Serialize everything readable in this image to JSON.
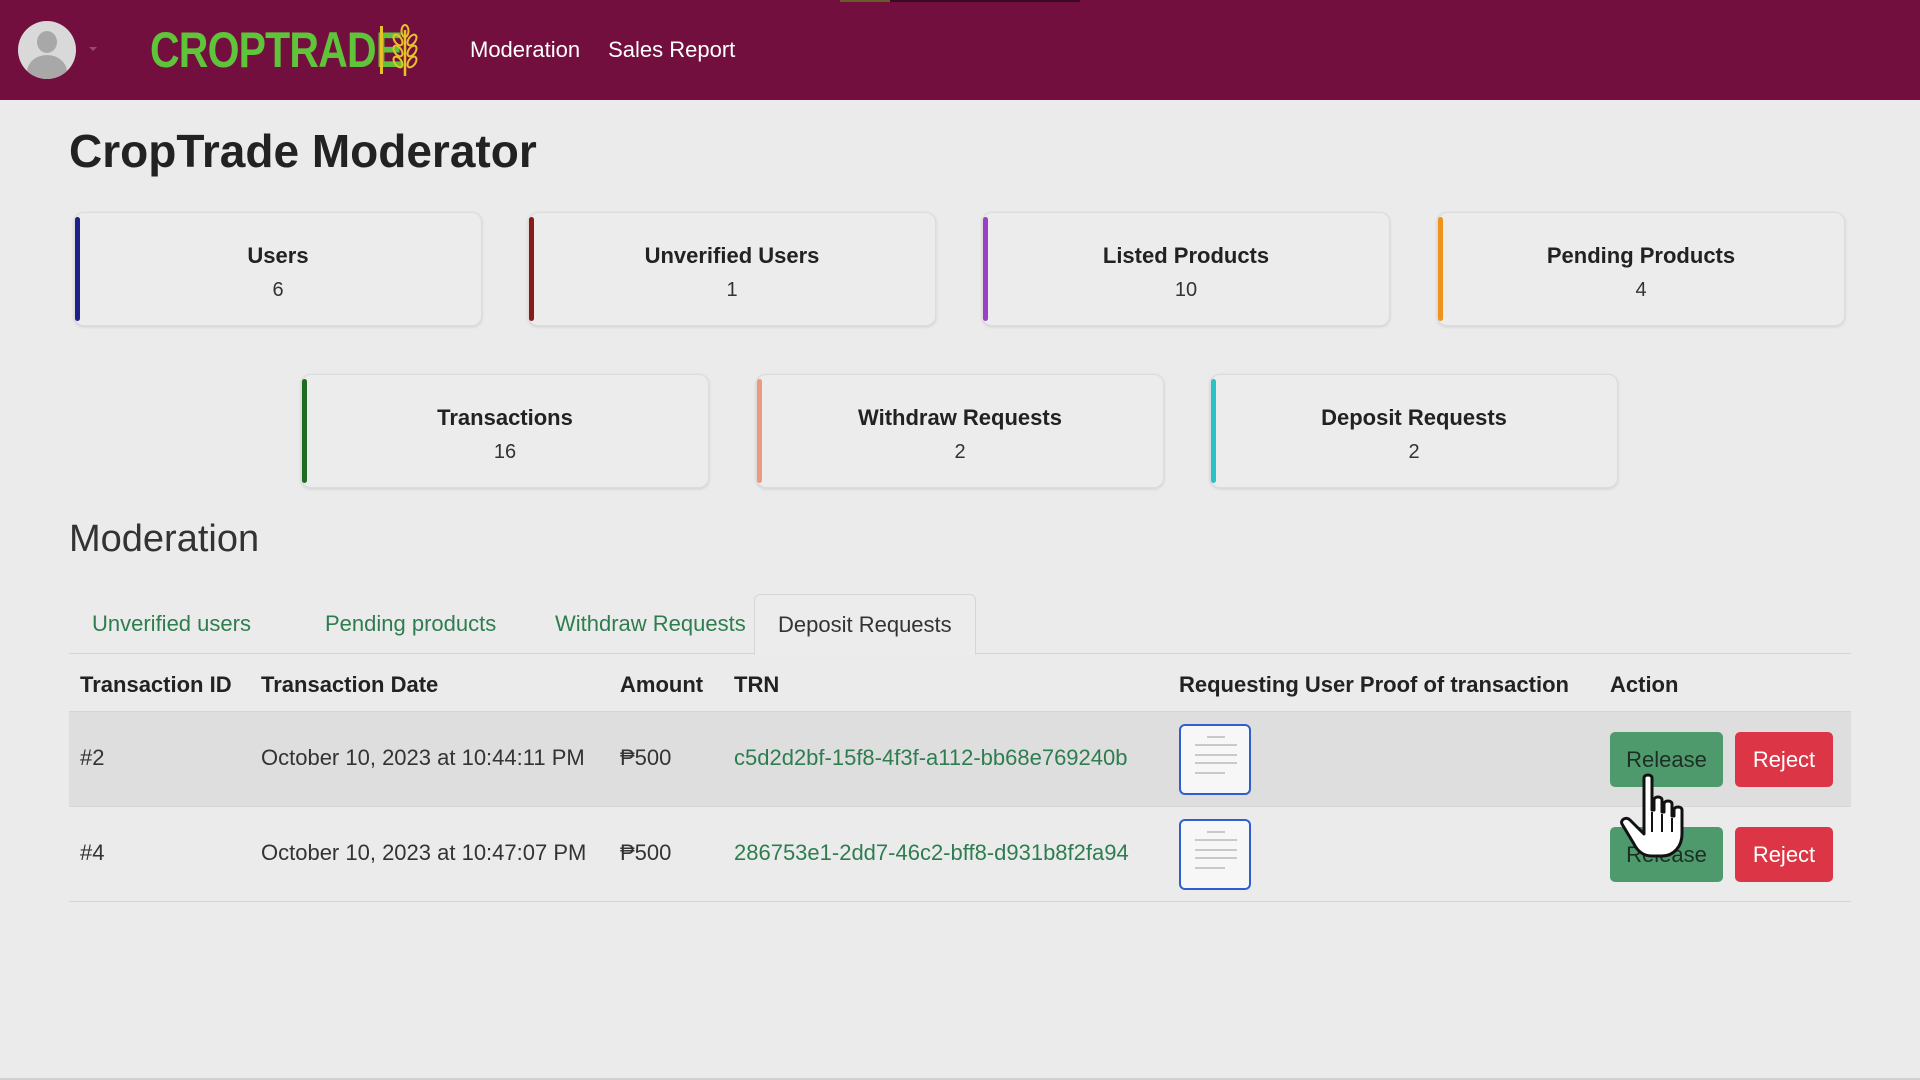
{
  "navbar": {
    "brand": "CROPTRADE",
    "links": [
      "Moderation",
      "Sales Report"
    ],
    "colors": {
      "background": "#730f3f",
      "brand": "#5ec43a",
      "brand_accent": "#e6c229"
    }
  },
  "page_title": "CropTrade Moderator",
  "stats": [
    {
      "label": "Users",
      "value": "6",
      "accent": "#1f1f8a"
    },
    {
      "label": "Unverified Users",
      "value": "1",
      "accent": "#8b1a1a"
    },
    {
      "label": "Listed Products",
      "value": "10",
      "accent": "#9b3fc9"
    },
    {
      "label": "Pending Products",
      "value": "4",
      "accent": "#f0921e"
    },
    {
      "label": "Transactions",
      "value": "16",
      "accent": "#1f6b24"
    },
    {
      "label": "Withdraw Requests",
      "value": "2",
      "accent": "#eb9a80"
    },
    {
      "label": "Deposit Requests",
      "value": "2",
      "accent": "#29c2c9"
    }
  ],
  "moderation": {
    "title": "Moderation",
    "tabs": [
      "Unverified users",
      "Pending products",
      "Withdraw Requests",
      "Deposit Requests"
    ],
    "active_tab": "Deposit Requests",
    "table": {
      "headers": [
        "Transaction ID",
        "Transaction Date",
        "Amount",
        "TRN",
        "Requesting User Proof of transaction",
        "Action"
      ],
      "rows": [
        {
          "id": "#2",
          "date": "October 10, 2023 at 10:44:11 PM",
          "amount": "₱500",
          "trn": "c5d2d2bf-15f8-4f3f-a112-bb68e769240b",
          "release": "Release",
          "reject": "Reject"
        },
        {
          "id": "#4",
          "date": "October 10, 2023 at 10:47:07 PM",
          "amount": "₱500",
          "trn": "286753e1-2dd7-46c2-bff8-d931b8f2fa94",
          "release": "Release",
          "reject": "Reject"
        }
      ]
    }
  },
  "icons": [
    "user-avatar-icon",
    "wheat-icon",
    "hand-pointer-icon",
    "document-thumbnail-icon"
  ]
}
